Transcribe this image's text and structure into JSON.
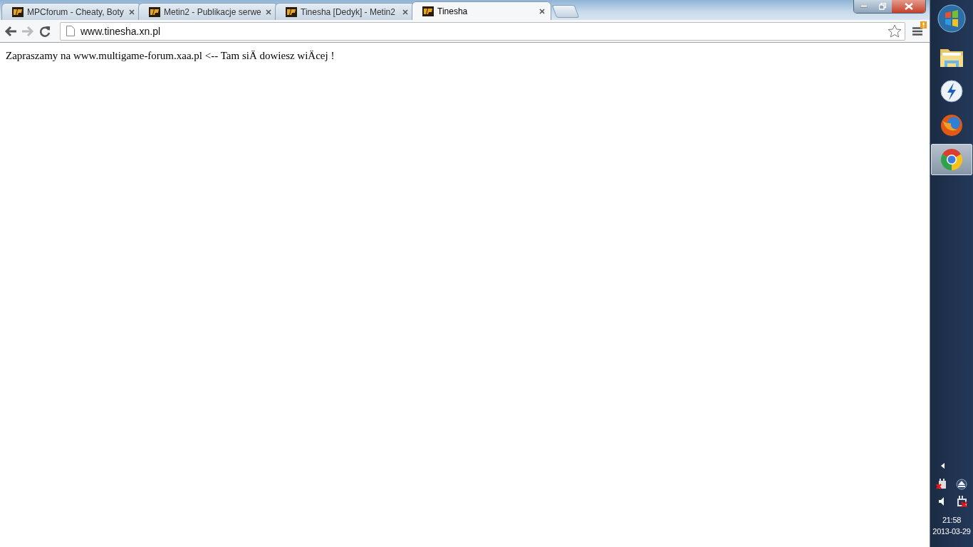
{
  "tabs": [
    {
      "title": "MPCforum - Cheaty, Boty",
      "selected": false
    },
    {
      "title": "Metin2 - Publikacje serwe",
      "selected": false
    },
    {
      "title": "Tinesha [Dedyk] - Metin2",
      "selected": false
    },
    {
      "title": "Tinesha",
      "selected": true
    }
  ],
  "address_bar": {
    "value": "www.tinesha.xn.pl"
  },
  "page": {
    "text": "Zapraszamy na www.multigame-forum.xaa.pl <-- Tam siÄ dowiesz wiÄcej !"
  },
  "taskbar": {
    "apps": [
      {
        "kind": "folder",
        "selected": false
      },
      {
        "kind": "lightning",
        "selected": false
      },
      {
        "kind": "firefox",
        "selected": false
      },
      {
        "kind": "chrome",
        "selected": true
      }
    ],
    "time": "21:58",
    "date": "2013-03-29"
  }
}
